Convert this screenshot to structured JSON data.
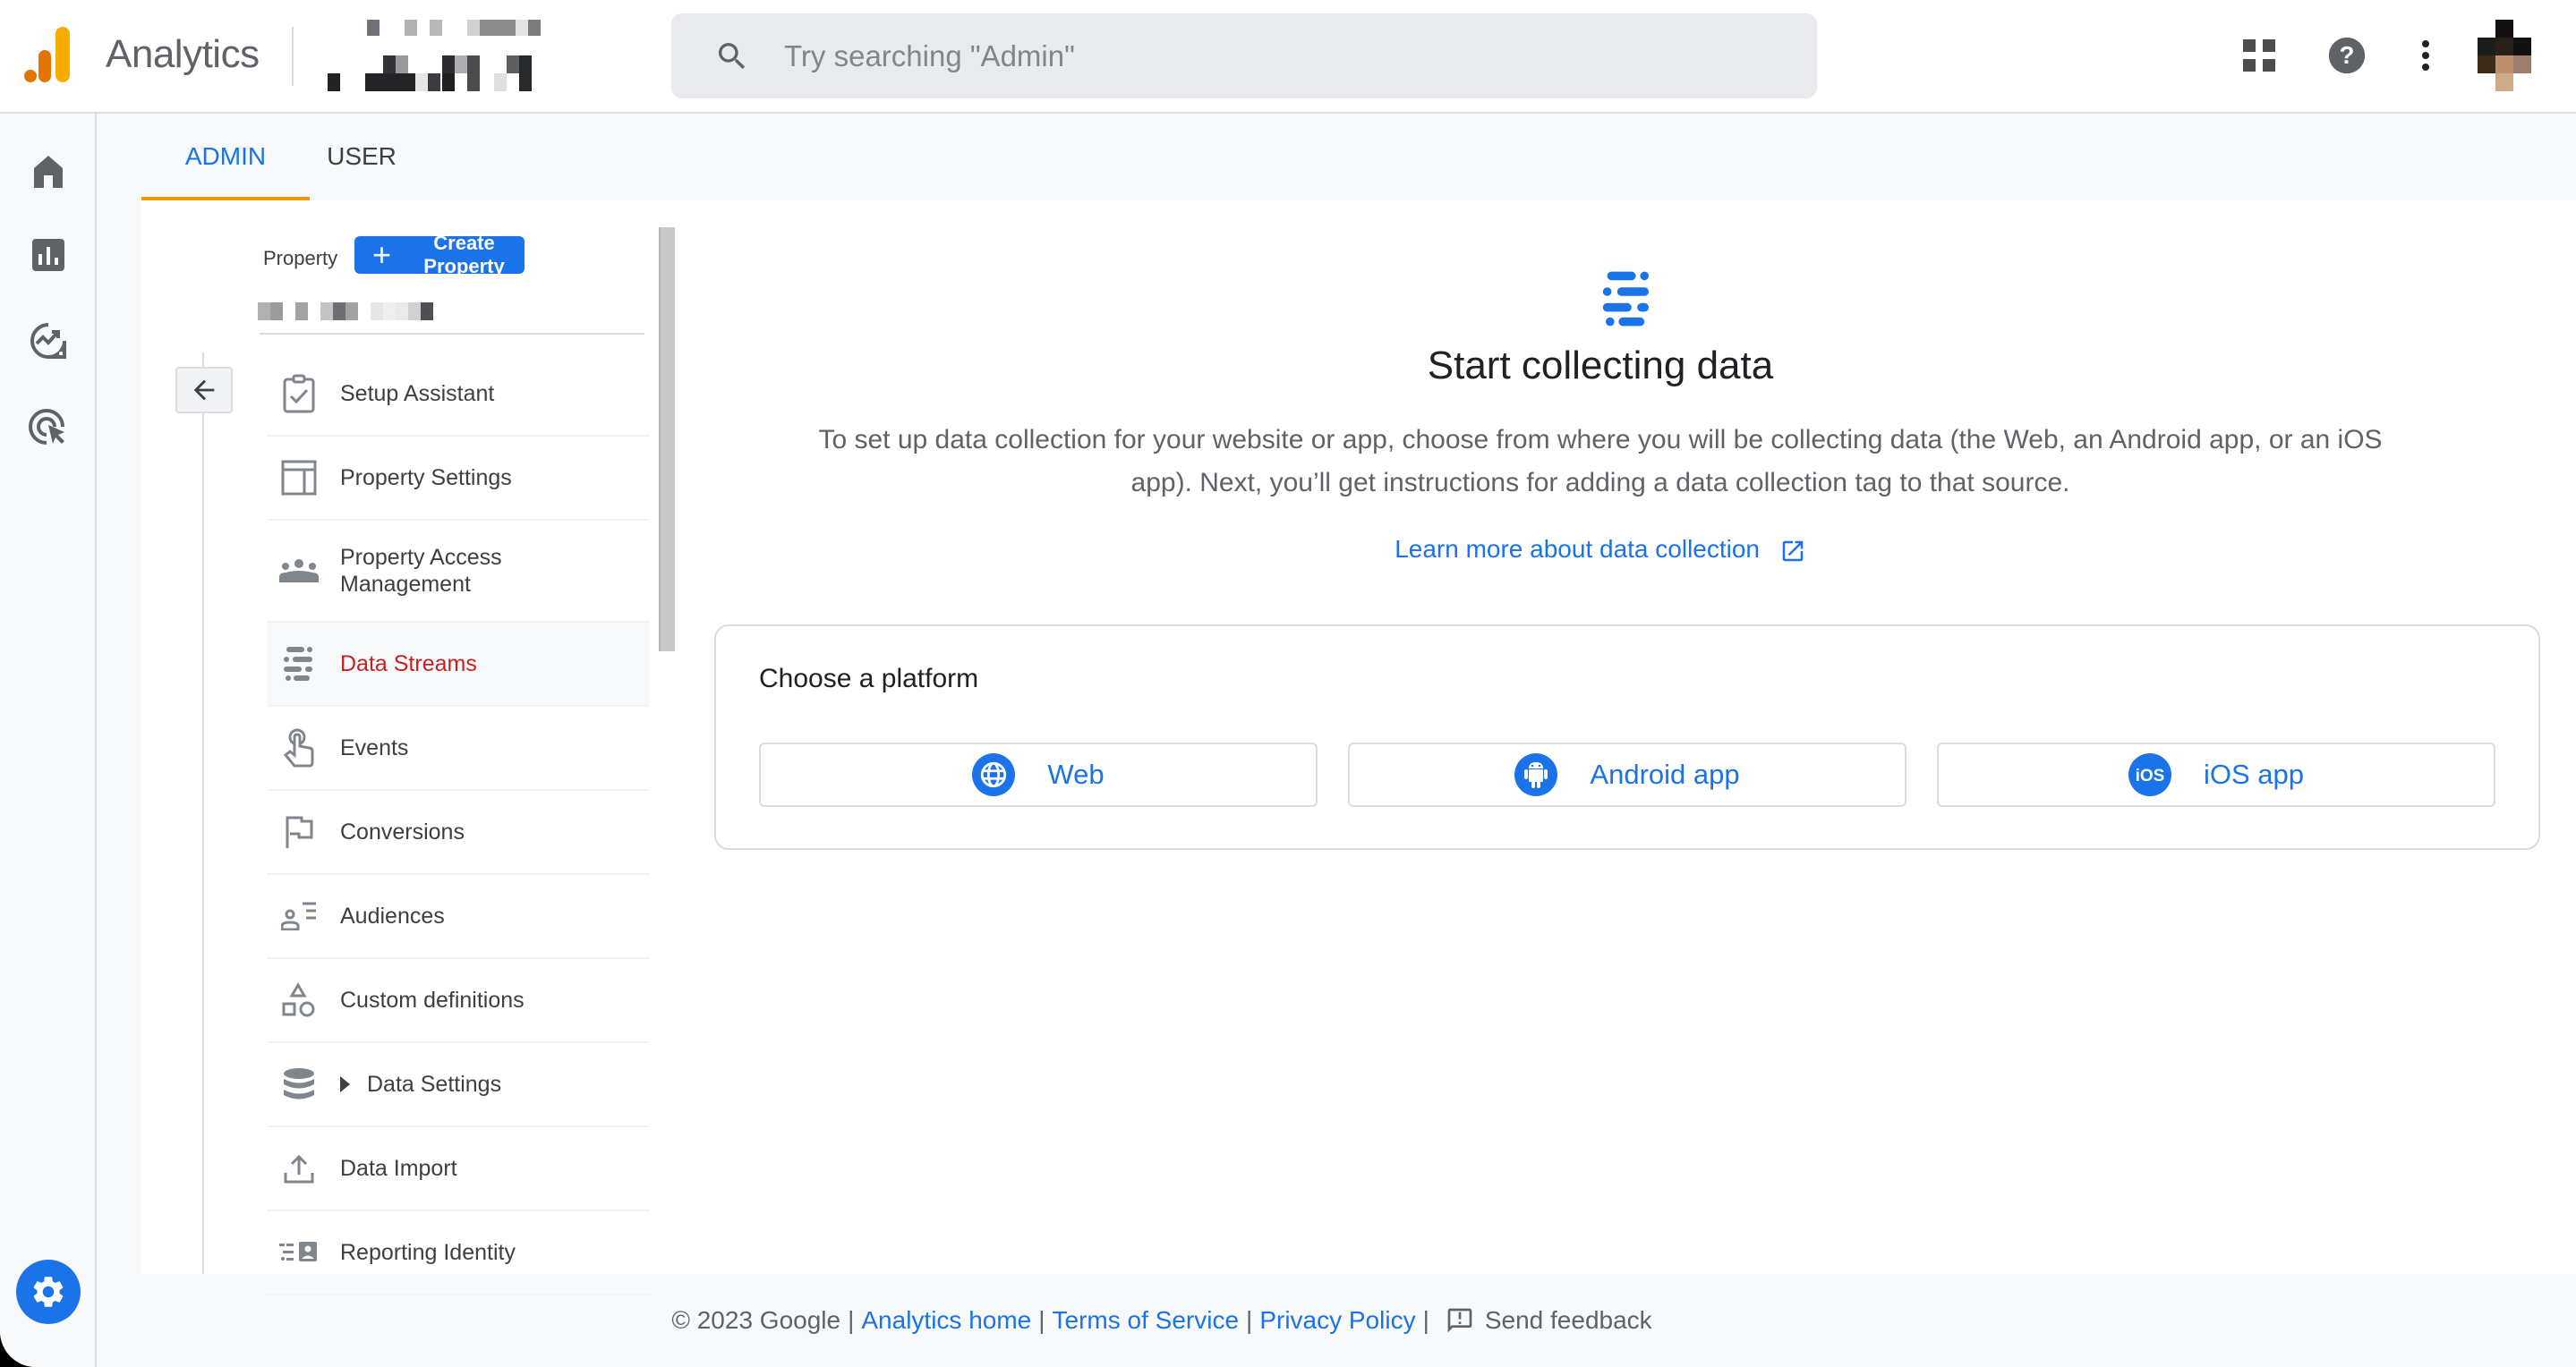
{
  "app": {
    "name": "Analytics",
    "brand_colors": {
      "logo_dark": "#e37400",
      "logo_light": "#f9ab00",
      "accent": "#1a73e8",
      "tab_indicator": "#f29900",
      "selected_text": "#c5221f"
    }
  },
  "topbar": {
    "search": {
      "placeholder": "Try searching \"Admin\"",
      "value": ""
    },
    "icons": [
      "apps-grid-icon",
      "help-icon",
      "more-vert-icon",
      "avatar"
    ]
  },
  "rail": {
    "items": [
      {
        "name": "home",
        "icon": "home-icon"
      },
      {
        "name": "reports",
        "icon": "bar-chart-icon"
      },
      {
        "name": "explore",
        "icon": "explore-trend-icon"
      },
      {
        "name": "advertising",
        "icon": "ads-click-icon"
      }
    ],
    "settings_icon": "gear-icon"
  },
  "tabs": [
    {
      "label": "ADMIN",
      "active": true
    },
    {
      "label": "USER",
      "active": false
    }
  ],
  "property": {
    "label": "Property",
    "create_button": "Create Property",
    "create_icon": "plus-icon"
  },
  "nav": {
    "items": [
      {
        "label": "Setup Assistant",
        "icon": "clipboard-check-icon",
        "selected": false
      },
      {
        "label": "Property Settings",
        "icon": "layout-icon",
        "selected": false
      },
      {
        "label": "Property Access Management",
        "label_line1": "Property Access",
        "label_line2": "Management",
        "icon": "people-icon",
        "selected": false
      },
      {
        "label": "Data Streams",
        "icon": "data-streams-icon",
        "selected": true
      },
      {
        "label": "Events",
        "icon": "touch-icon",
        "selected": false
      },
      {
        "label": "Conversions",
        "icon": "flag-icon",
        "selected": false
      },
      {
        "label": "Audiences",
        "icon": "audience-icon",
        "selected": false
      },
      {
        "label": "Custom definitions",
        "icon": "shapes-icon",
        "selected": false
      },
      {
        "label": "Data Settings",
        "icon": "database-icon",
        "selected": false,
        "expandable": true
      },
      {
        "label": "Data Import",
        "icon": "upload-icon",
        "selected": false
      },
      {
        "label": "Reporting Identity",
        "icon": "reporting-identity-icon",
        "selected": false
      }
    ]
  },
  "main": {
    "title": "Start collecting data",
    "description": "To set up data collection for your website or app, choose from where you will be collecting data (the Web, an Android app, or an iOS app). Next, you’ll get instructions for adding a data collection tag to that source.",
    "learn_more": "Learn more about data collection",
    "platform_card": {
      "title": "Choose a platform",
      "options": [
        {
          "label": "Web",
          "icon": "globe-icon"
        },
        {
          "label": "Android app",
          "icon": "android-icon"
        },
        {
          "label": "iOS app",
          "icon": "ios-icon"
        }
      ]
    }
  },
  "footer": {
    "copyright": "© 2023 Google",
    "links": [
      "Analytics home",
      "Terms of Service",
      "Privacy Policy"
    ],
    "separator": "|",
    "feedback": "Send feedback"
  }
}
